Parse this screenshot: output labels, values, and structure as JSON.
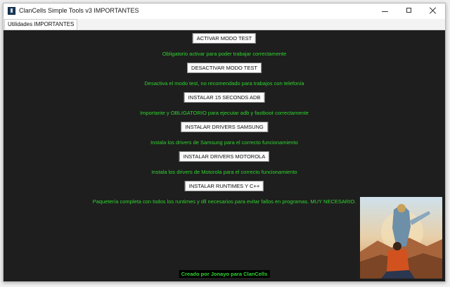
{
  "window": {
    "title": "ClanCells Simple Tools v3 IMPORTANTES",
    "icon": "app-icon"
  },
  "menu": {
    "tab_label": "Utilidades IMPORTANTES"
  },
  "actions": [
    {
      "button": "ACTIVAR MODO TEST",
      "description": "Obligatorio activar para poder trabajar correctamente"
    },
    {
      "button": "DESACTIVAR MODO TEST",
      "description": "Desactiva el modo test, no recomendado para trabajos con telefonía"
    },
    {
      "button": "INSTALAR 15 SECONDS ADB",
      "description": "Importante y OBLIGATORIO para ejecutar adb y fastboot correctamente"
    },
    {
      "button": "INSTALAR DRIVERS SAMSUNG",
      "description": "Instala los drivers de Samsung para el correcto funcionamiento"
    },
    {
      "button": "INSTALAR DRIVERS MOTOROLA",
      "description": "Instala los drivers de Motorola para el correcto funcionamiento"
    },
    {
      "button": "INSTALAR RUNTIMES Y C++",
      "description": "Paquetería completa con todos los runtimes y dll necesarios para evitar fallos en programas. MUY NECESARIO."
    }
  ],
  "footer": {
    "credit": "Creado por Jonayo para ClanCells"
  },
  "colors": {
    "background": "#1e1e1e",
    "description_text": "#2fd52f",
    "button_face": "#fbfbfb"
  }
}
